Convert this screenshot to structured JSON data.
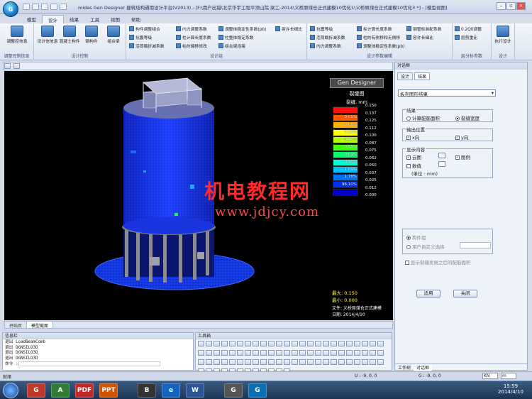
{
  "window": {
    "title": "midas Gen Designer 建筑结构通用设计平台(V2013) - [F:\\用户出错\\北京华宇工程平顶山院  梁工-2014\\义桥原煤仓正式建模10优化1\\义桥原煤仓正式建模10优化3 *] - [模型视图]",
    "app_badge": "G"
  },
  "tabs": [
    "模型",
    "设计",
    "结果",
    "工具",
    "视图",
    "帮助"
  ],
  "active_tab": "设计",
  "ribbon": {
    "groups": [
      {
        "label": "调整控制信息",
        "buttons": [
          "调整控信息"
        ]
      },
      {
        "label": "设计控制",
        "buttons": [
          "设计信信息",
          "混凝土构件",
          "钢构件",
          "组合梁"
        ]
      },
      {
        "label": "设计组",
        "small": [
          "构件调整组合",
          "内力调整系数",
          "调整体稳定性系数(pb)",
          "容许长细比",
          "抗震等级",
          "柱计算长度系数",
          "柱整体稳定系数",
          "活荷载折减系数",
          "柱的偏移修改",
          "组合梁连接"
        ]
      },
      {
        "label": "设计参数编辑",
        "small": [
          "抗震等级",
          "柱计算长度系数",
          "钢管标准配系数",
          "活荷载折减系数",
          "柱的有侧移和无侧移",
          "容许长细比",
          "内力调整系数",
          "调整体稳定性系数(pb)"
        ]
      },
      {
        "label": "层分析参数",
        "buttons": [
          "0.2Q0调整",
          "层剪重比"
        ]
      },
      {
        "label": "设计",
        "buttons": [
          "执行设计"
        ]
      }
    ]
  },
  "view_tabs": [
    "开始页",
    "模型截面"
  ],
  "legend": {
    "brand": "Gen Designer",
    "title": "裂缝图",
    "subtitle": "裂缝, mm",
    "values": [
      "0.150",
      "0.137",
      "0.125",
      "0.112",
      "0.100",
      "0.087",
      "0.075",
      "0.062",
      "0.050",
      "0.037",
      "0.025",
      "0.012",
      "0.000"
    ],
    "percents": [
      "0.01%",
      "0.08%",
      "0.23%",
      "0.42%",
      "0.55%",
      "0.69%",
      "0.96%",
      "1.09%",
      "1.78%",
      "96.10%"
    ],
    "colors": [
      "#ff1010",
      "#ff5a00",
      "#ffb000",
      "#ffff00",
      "#b4ff00",
      "#44ff10",
      "#00ff70",
      "#00ffd0",
      "#00c0ff",
      "#0070ff",
      "#0030ff",
      "#0000c8"
    ],
    "max_label": "最大: 0.150",
    "min_label": "最小: 0.000",
    "file_label": "文件: 义桥原煤仓正式建模",
    "date_label": "日期: 2014/4/10"
  },
  "watermark": {
    "main": "机电教程网",
    "url": "www.jdjcy.com"
  },
  "right_panel": {
    "header": "对话框",
    "tabs": [
      "设计",
      "结果"
    ],
    "active_tab": "结果",
    "dropdown": "板壳图形结果",
    "result_group": "结果",
    "radio_area": "计算配筋面积",
    "radio_crack": "裂缝宽度",
    "output_group": "输出位置",
    "x_dir": "x向",
    "y_dir": "y向",
    "display_group": "显示内容",
    "contour": "云图",
    "legend_cb": "图例",
    "values": "数值",
    "unit": "(单位 : mm)",
    "component": "构件组",
    "user_select": "用户自定义选择",
    "show_note": "显示裂缝发展之后的配筋面积",
    "apply": "适用",
    "close": "关闭",
    "bottom_tabs": [
      "工作树",
      "对话框"
    ]
  },
  "info_panel": {
    "header": "信息栏",
    "lines": [
      "退出 LoadBeamComb",
      "退出 DGNSILO3D",
      "退出 DGNSILO3D",
      "退出 DGNSILO3D"
    ],
    "prompt": "命令 :"
  },
  "tool_panel": {
    "header": "工具箱"
  },
  "statusbar": {
    "left": "就绪",
    "coord1": "U : -9, 0, 0",
    "coord2": "G : -9, 0, 0",
    "unit1": "KN",
    "unit2": "m"
  },
  "taskbar": {
    "time": "15:59",
    "date": "2014/4/10",
    "apps": [
      "G",
      "A",
      "PDF",
      "PPT",
      "B",
      "e",
      "W",
      "G",
      "G"
    ]
  }
}
